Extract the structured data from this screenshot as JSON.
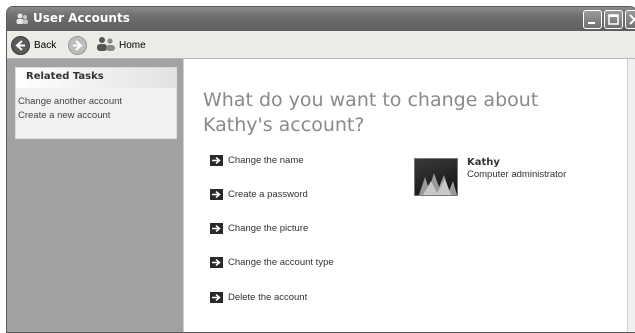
{
  "window": {
    "title": "User Accounts",
    "minimize_icon": "minimize-icon",
    "maximize_icon": "maximize-icon",
    "close_icon": "close-icon"
  },
  "toolbar": {
    "back_label": "Back",
    "home_label": "Home"
  },
  "sidebar": {
    "related_tasks_title": "Related Tasks",
    "links": [
      "Change another account",
      "Create a new account"
    ]
  },
  "main": {
    "heading": "What do you want to change about Kathy's account?",
    "actions": [
      "Change the name",
      "Create a password",
      "Change the picture",
      "Change the account type",
      "Delete the account"
    ],
    "user": {
      "name": "Kathy",
      "role": "Computer administrator"
    }
  }
}
